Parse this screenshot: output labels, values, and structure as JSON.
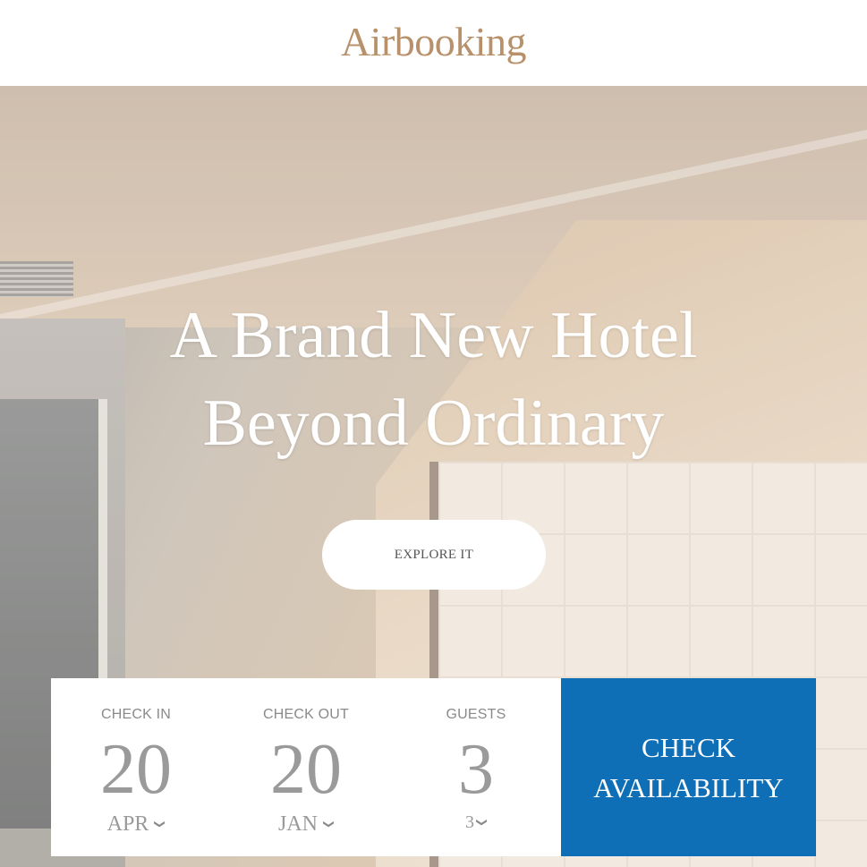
{
  "header": {
    "logo": "Airbooking"
  },
  "hero": {
    "headline_line1": "A Brand New Hotel",
    "headline_line2": "Beyond Ordinary",
    "explore_label": "EXPLORE IT"
  },
  "booking": {
    "check_in": {
      "label": "CHECK IN",
      "day": "20",
      "month": "APR"
    },
    "check_out": {
      "label": "CHECK OUT",
      "day": "20",
      "month": "JAN"
    },
    "guests": {
      "label": "GUESTS",
      "count": "3",
      "selected": "3"
    },
    "button_line1": "CHECK",
    "button_line2": "AVAILABILITY"
  },
  "colors": {
    "brand": "#b8916b",
    "accent": "#0e6fb6"
  },
  "icons": {
    "dropdown": "chevron-down-icon"
  }
}
